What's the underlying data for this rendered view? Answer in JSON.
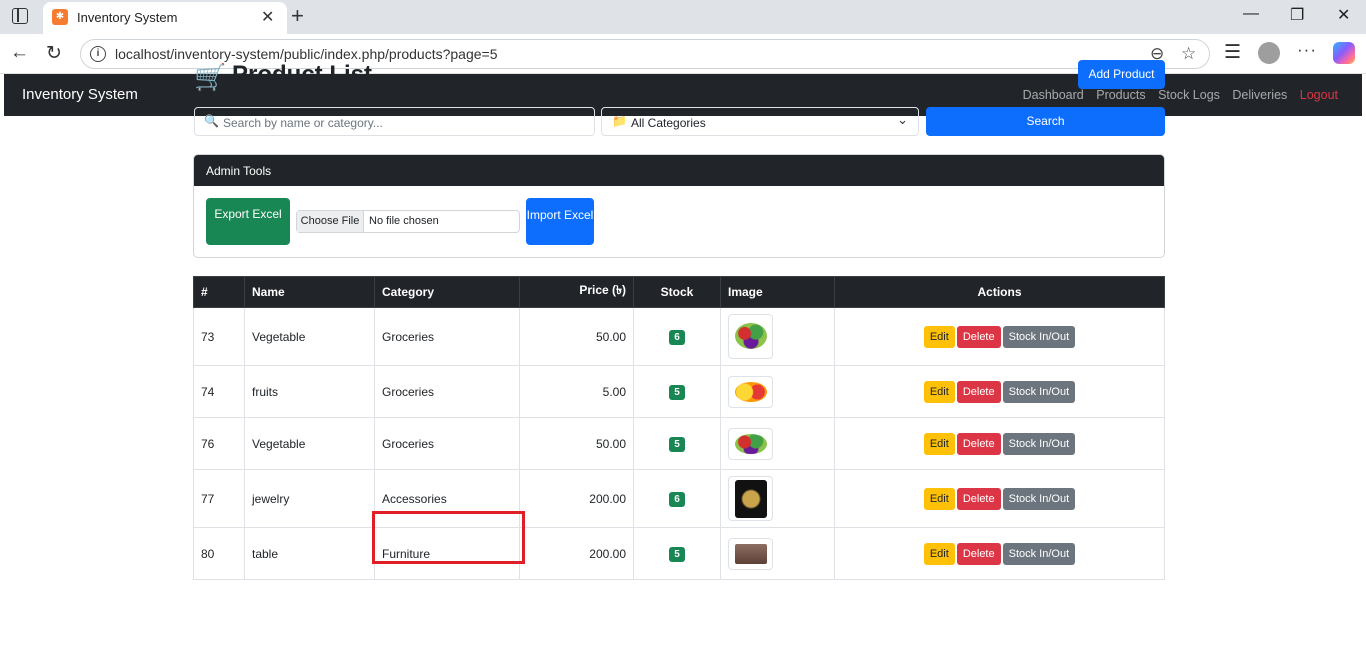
{
  "browser": {
    "tab_title": "Inventory System",
    "url": "localhost/inventory-system/public/index.php/products?page=5"
  },
  "navbar": {
    "brand": "Inventory System",
    "links": [
      "Dashboard",
      "Products",
      "Stock Logs",
      "Deliveries"
    ],
    "logout": "Logout"
  },
  "header": {
    "title": "Product List",
    "add_button": "Add Product"
  },
  "filters": {
    "search_placeholder": "Search by name or category...",
    "category_value": "All Categories",
    "search_button": "Search"
  },
  "admin_tools": {
    "title": "Admin Tools",
    "export_button": "Export Excel",
    "file_button": "Choose File",
    "file_status": "No file chosen",
    "import_button": "Import Excel"
  },
  "table": {
    "headers": [
      "#",
      "Name",
      "Category",
      "Price (৳)",
      "Stock",
      "Image",
      "Actions"
    ],
    "rows": [
      {
        "id": "73",
        "name": "Vegetable",
        "category": "Groceries",
        "price": "50.00",
        "stock": "6",
        "image": "vegetables"
      },
      {
        "id": "74",
        "name": "fruits",
        "category": "Groceries",
        "price": "5.00",
        "stock": "5",
        "image": "fruits"
      },
      {
        "id": "76",
        "name": "Vegetable",
        "category": "Groceries",
        "price": "50.00",
        "stock": "5",
        "image": "vegetables"
      },
      {
        "id": "77",
        "name": "jewelry",
        "category": "Accessories",
        "price": "200.00",
        "stock": "6",
        "image": "necklace"
      },
      {
        "id": "80",
        "name": "table",
        "category": "Furniture",
        "price": "200.00",
        "stock": "5",
        "image": "table"
      }
    ],
    "actions": {
      "edit": "Edit",
      "delete": "Delete",
      "stock": "Stock In/Out"
    }
  },
  "colors": {
    "primary": "#0d6efd",
    "success": "#198754",
    "warning": "#ffc107",
    "danger": "#dc3545",
    "secondary": "#6c757d",
    "dark": "#212529",
    "highlight": "#e01e26"
  }
}
